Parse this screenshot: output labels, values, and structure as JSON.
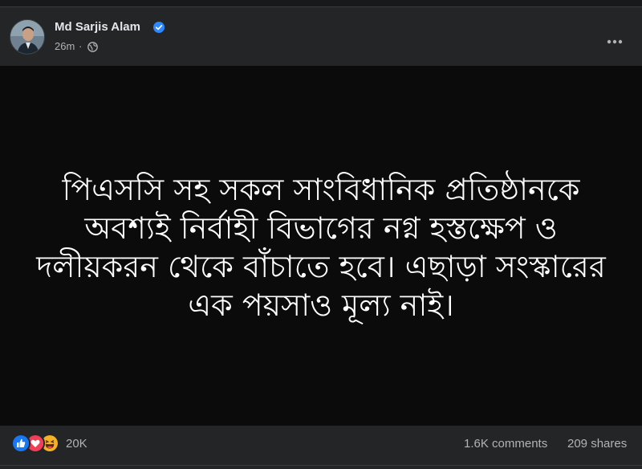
{
  "author": {
    "name": "Md Sarjis Alam",
    "verified": true,
    "timestamp": "26m",
    "separator": "·",
    "audience_icon": "globe-icon"
  },
  "menu": {
    "icon": "more-horizontal-icon",
    "dots": "•••"
  },
  "post": {
    "background": "#0b0b0c",
    "text_color": "#ffffff",
    "lines": [
      "পিএসসি সহ সকল সাংবিধানিক প্রতিষ্ঠানকে",
      "অবশ্যই নির্বাহী বিভাগের নগ্ন হস্তক্ষেপ ও",
      "দলীয়করন থেকে বাঁচাতে হবে। এছাড়া সংস্কারের",
      "এক পয়সাও মূল্য নাই।"
    ]
  },
  "engagement": {
    "reaction_icons": [
      "like-icon",
      "love-icon",
      "haha-icon"
    ],
    "reaction_count": "20K",
    "comments": "1.6K comments",
    "shares": "209 shares"
  },
  "colors": {
    "card": "#242526",
    "secondary_text": "#b0b3b8",
    "primary_text": "#e4e6eb",
    "verified_blue": "#2d88ff",
    "like_blue": "#1877f2",
    "love_red": "#f33e58",
    "haha_yellow": "#f7b125"
  }
}
